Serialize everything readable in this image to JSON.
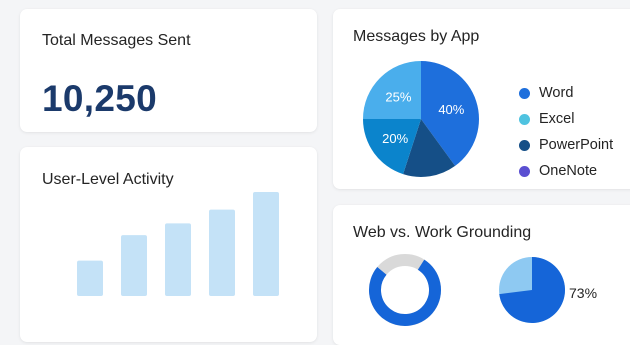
{
  "cards": {
    "total_messages": {
      "title": "Total Messages Sent",
      "value": "10,250"
    },
    "user_activity": {
      "title": "User-Level Activity"
    },
    "messages_by_app": {
      "title": "Messages by App"
    },
    "grounding": {
      "title": "Web vs. Work Grounding",
      "pie_label": "73%"
    }
  },
  "colors": {
    "word": "#1e6fdc",
    "excel": "#4fc3e0",
    "powerpoint": "#154f87",
    "onenote": "#5a4fd1",
    "bar": "#c4e2f7",
    "ring_track": "#d9d9d9",
    "ring_fill": "#1565d8",
    "pie_main": "#1565d8",
    "pie_light": "#8ec9f2"
  },
  "chart_data": [
    {
      "type": "bar",
      "title": "User-Level Activity",
      "values": [
        18,
        31,
        37,
        44,
        53
      ]
    },
    {
      "type": "pie",
      "title": "Messages by App",
      "legend": [
        "Word",
        "Excel",
        "PowerPoint",
        "OneNote"
      ],
      "slices": [
        {
          "label": "Word",
          "value": 40,
          "text": "40%",
          "color": "#1e6fdc"
        },
        {
          "label": "PowerPoint",
          "value": 15,
          "text": "",
          "color": "#154f87"
        },
        {
          "label": "Excel",
          "value": 20,
          "text": "20%",
          "color": "#0b84cc"
        },
        {
          "label": "Excel",
          "value": 25,
          "text": "25%",
          "color": "#4aaeec"
        }
      ]
    },
    {
      "type": "pie",
      "title": "Web vs. Work Grounding",
      "donut": {
        "value": 77
      },
      "pie": {
        "value": 73,
        "label": "73%"
      }
    }
  ]
}
